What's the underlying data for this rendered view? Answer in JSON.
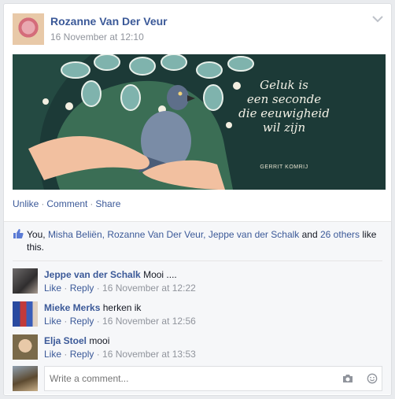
{
  "post": {
    "author": "Rozanne Van Der Veur",
    "timestamp": "16 November at 12:10",
    "image": {
      "quote_lines": [
        "Geluk is",
        "een seconde",
        "die eeuwigheid",
        "wil zijn"
      ],
      "quote_author": "GERRIT KOMRIJ"
    }
  },
  "actions": {
    "unlike": "Unlike",
    "comment": "Comment",
    "share": "Share",
    "separator": "·"
  },
  "likes": {
    "you": "You,",
    "names": [
      "Misha Beliën,",
      "Rozanne Van Der Veur,",
      "Jeppe van der Schalk"
    ],
    "and": "and",
    "others": "26 others",
    "suffix": "like this."
  },
  "comments": [
    {
      "name": "Jeppe van der Schalk",
      "text": "Mooi ....",
      "like": "Like",
      "reply": "Reply",
      "time": "16 November at 12:22"
    },
    {
      "name": "Mieke Merks",
      "text": "herken ik",
      "like": "Like",
      "reply": "Reply",
      "time": "16 November at 12:56"
    },
    {
      "name": "Elja Stoel",
      "text": "mooi",
      "like": "Like",
      "reply": "Reply",
      "time": "16 November at 13:53"
    }
  ],
  "comment_box": {
    "placeholder": "Write a comment..."
  },
  "colors": {
    "link": "#3b5998",
    "meta": "#90949c",
    "image_bg": "#1c3a37"
  }
}
